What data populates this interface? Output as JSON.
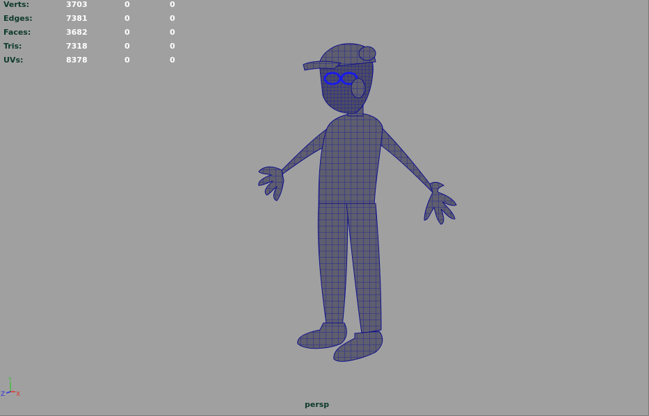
{
  "hud": {
    "rows": [
      {
        "label": "Verts:",
        "v1": "3703",
        "v2": "0",
        "v3": "0"
      },
      {
        "label": "Edges:",
        "v1": "7381",
        "v2": "0",
        "v3": "0"
      },
      {
        "label": "Faces:",
        "v1": "3682",
        "v2": "0",
        "v3": "0"
      },
      {
        "label": "Tris:",
        "v1": "7318",
        "v2": "0",
        "v3": "0"
      },
      {
        "label": "UVs:",
        "v1": "8378",
        "v2": "0",
        "v3": "0"
      }
    ]
  },
  "axis": {
    "y": "Y",
    "z": "Z",
    "x": "X"
  },
  "camera": {
    "name": "persp"
  },
  "colors": {
    "background": "#a0a0a0",
    "mesh_fill": "#5e5e6e",
    "wire": "#1a1aa0",
    "hud_label": "#0d3a2a",
    "hud_value": "#ffffff"
  }
}
